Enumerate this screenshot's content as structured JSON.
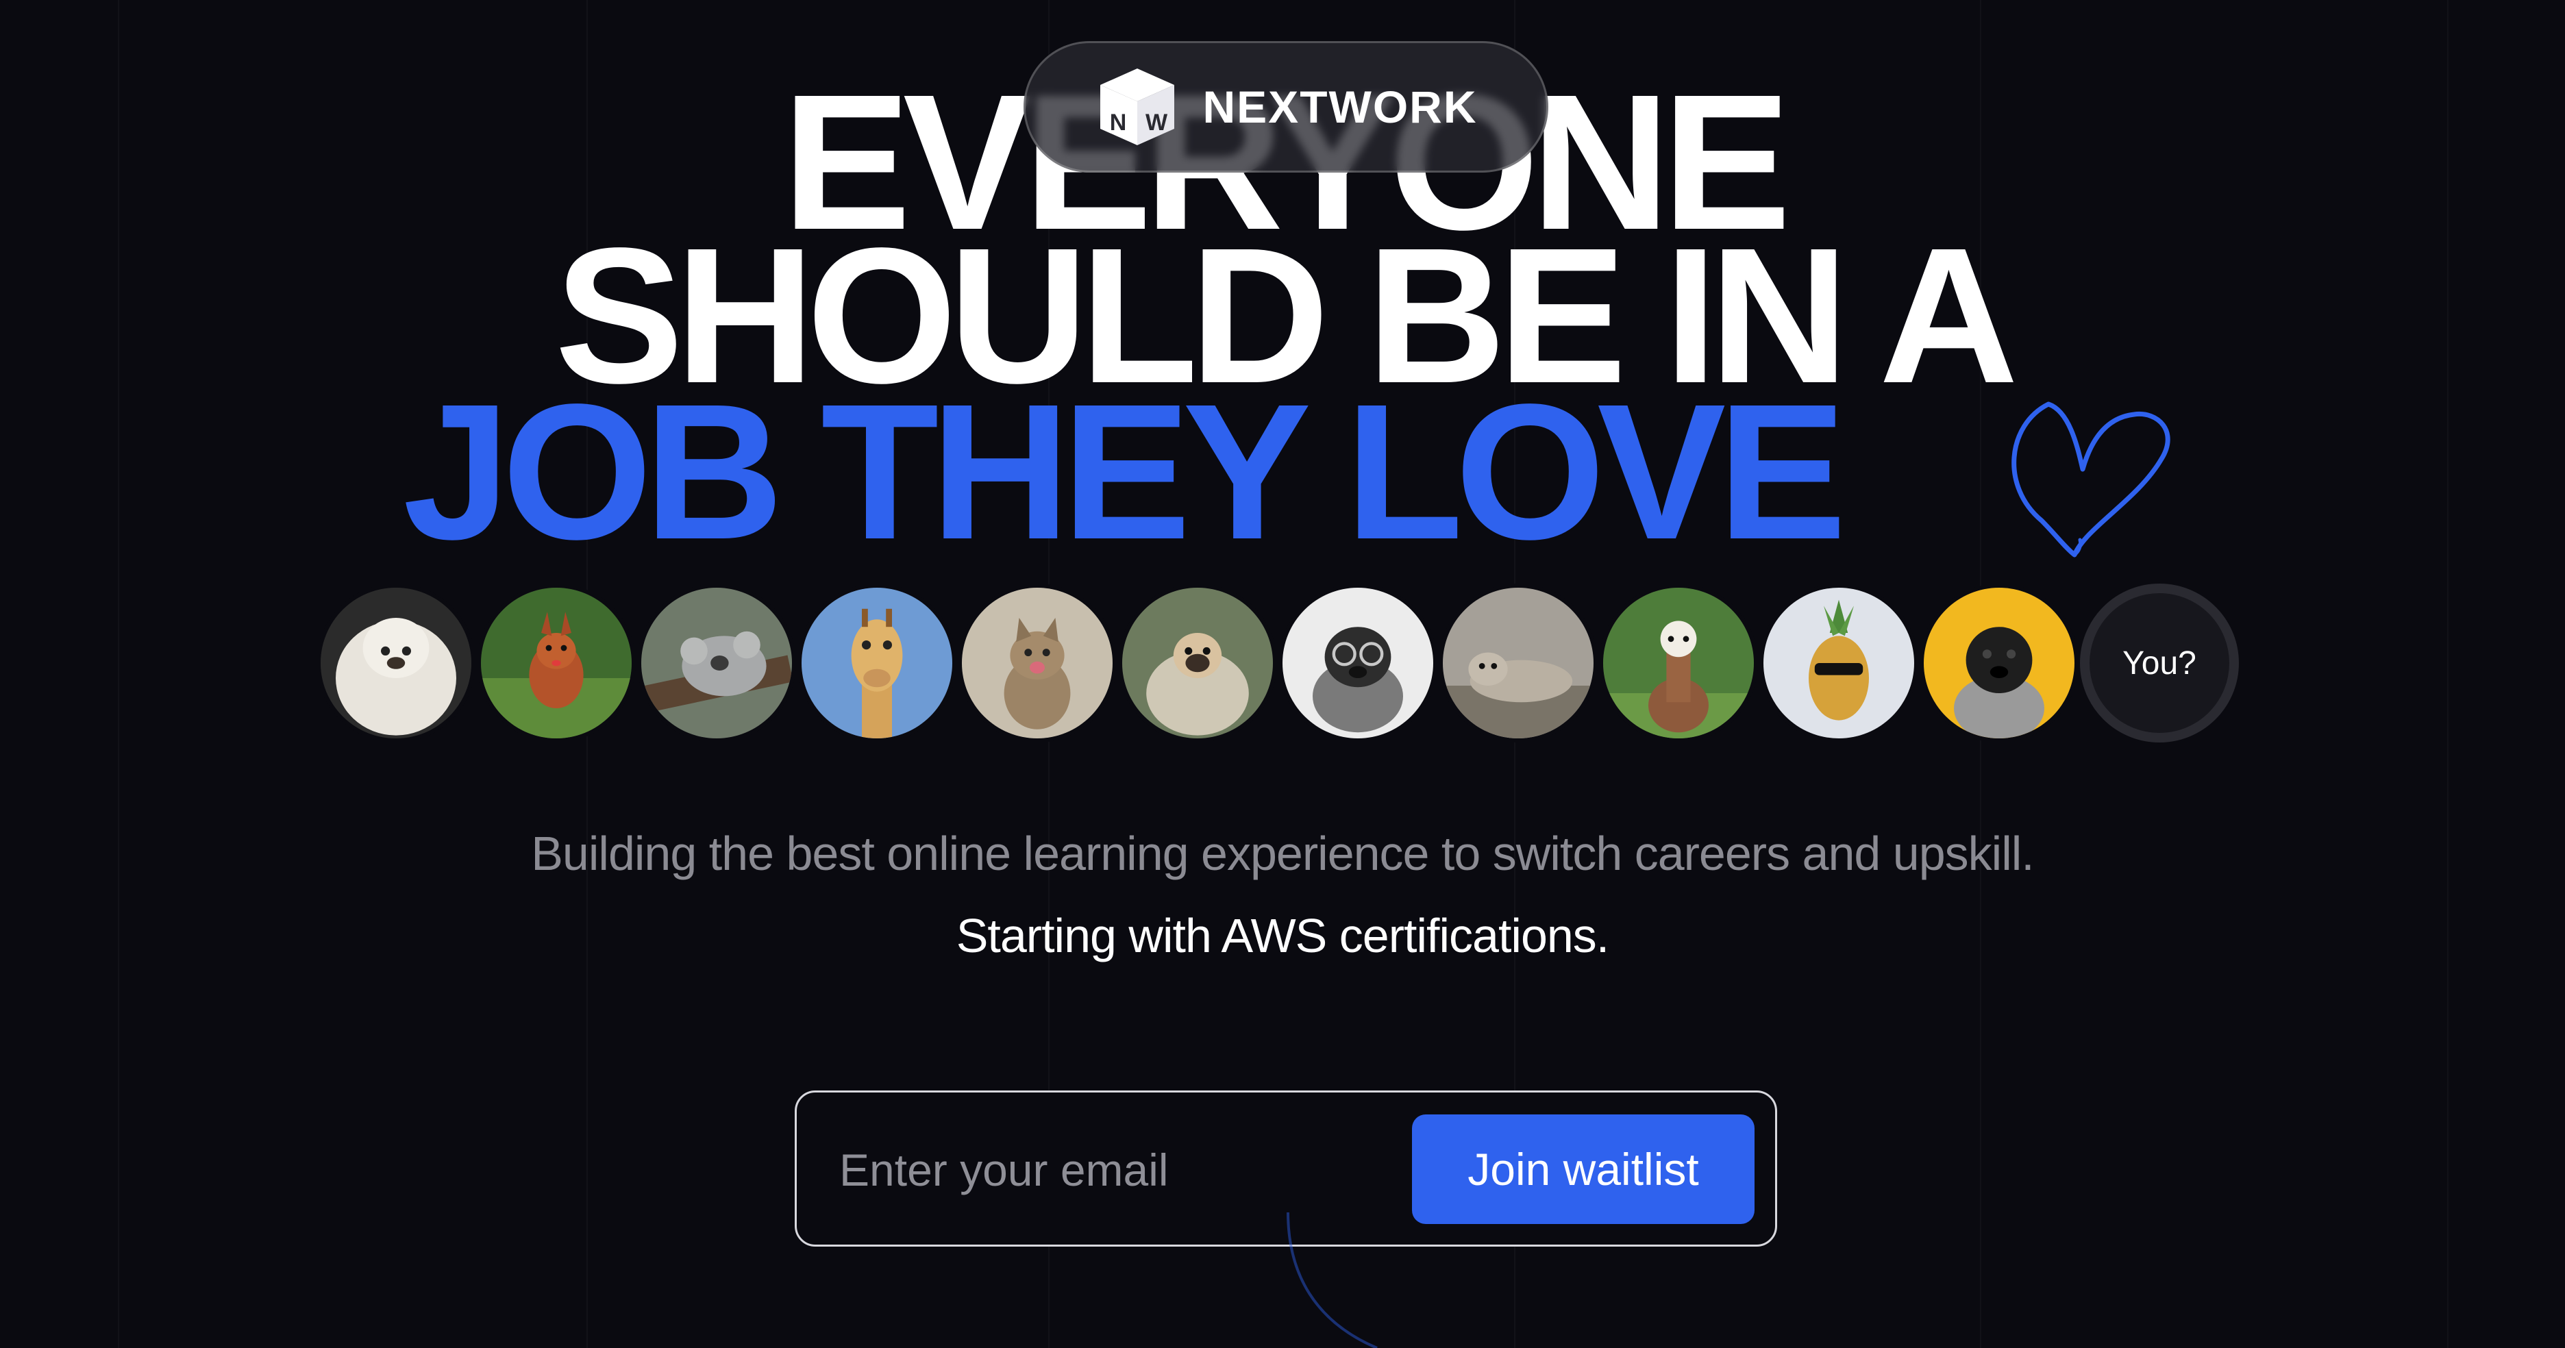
{
  "brand": {
    "name": "NEXTWORK",
    "logo_letters": "NW"
  },
  "headline": {
    "line1": "EVERYONE",
    "line2": "SHOULD BE IN A",
    "line3": "JOB THEY LOVE"
  },
  "avatars": {
    "items": [
      "white-fluffy-dog",
      "red-squirrel",
      "koala-sleeping",
      "giraffe",
      "kitten",
      "pug-in-blanket",
      "pug-with-glasses",
      "seal",
      "alpaca",
      "pineapple-with-sunglasses",
      "black-pug-yellow-background"
    ],
    "you_label": "You?"
  },
  "subtitle": "Building the best online learning experience to switch careers and upskill.",
  "subtitle2": "Starting with AWS certifications.",
  "signup": {
    "email_placeholder": "Enter your email",
    "button_label": "Join waitlist"
  },
  "colors": {
    "background": "#0a0a10",
    "accent_blue": "#2f62ee",
    "text_white": "#ffffff",
    "text_muted": "#8b8b93"
  }
}
